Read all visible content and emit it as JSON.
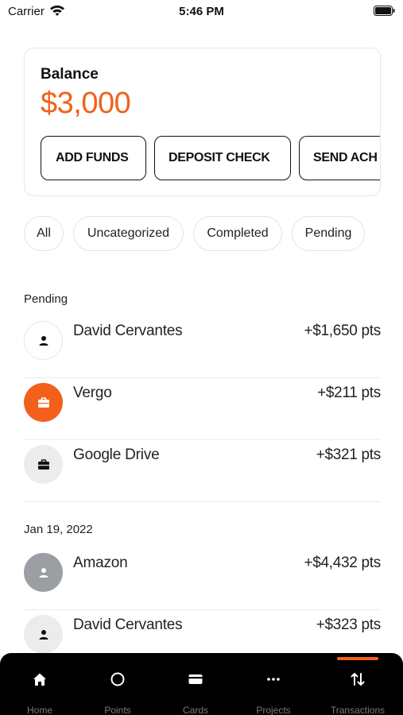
{
  "status_bar": {
    "carrier": "Carrier",
    "time": "5:46 PM"
  },
  "balance": {
    "label": "Balance",
    "amount": "$3,000",
    "actions": [
      "ADD FUNDS",
      "DEPOSIT CHECK",
      "SEND ACH"
    ]
  },
  "filters": [
    "All",
    "Uncategorized",
    "Completed",
    "Pending"
  ],
  "sections": [
    {
      "header": "Pending",
      "transactions": [
        {
          "name": "David Cervantes",
          "amount": "+$1,650 pts",
          "icon": "person-icon"
        },
        {
          "name": "Vergo",
          "amount": "+$211 pts",
          "icon": "briefcase-icon"
        },
        {
          "name": "Google Drive",
          "amount": "+$321 pts",
          "icon": "briefcase-icon"
        }
      ]
    },
    {
      "header": "Jan 19, 2022",
      "transactions": [
        {
          "name": "Amazon",
          "amount": "+$4,432 pts",
          "icon": "person-icon"
        },
        {
          "name": "David Cervantes",
          "amount": "+$323 pts",
          "icon": "person-icon"
        }
      ]
    }
  ],
  "tab_bar": {
    "items": [
      {
        "label": "Home",
        "icon": "home-icon"
      },
      {
        "label": "Points",
        "icon": "circle-icon"
      },
      {
        "label": "Cards",
        "icon": "card-icon"
      },
      {
        "label": "Projects",
        "icon": "more-icon"
      },
      {
        "label": "Transactions",
        "icon": "transfer-icon"
      }
    ],
    "active": "Transactions"
  },
  "colors": {
    "accent": "#f2601c",
    "tab_bar_bg": "#000000",
    "avatar_grey": "#9b9ea3"
  }
}
